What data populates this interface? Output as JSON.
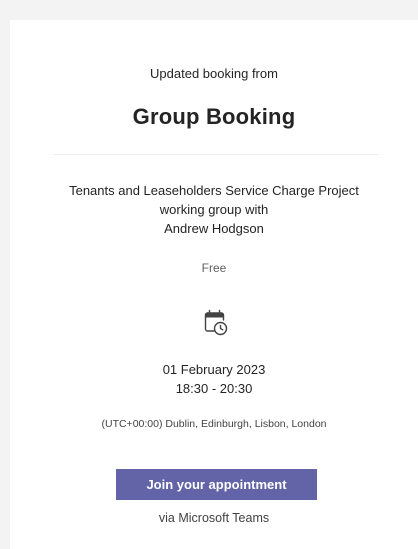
{
  "booking": {
    "intro": "Updated booking from",
    "business_name": "Group Booking",
    "service_lines": [
      "Tenants and Leaseholders Service Charge Project",
      "working group with",
      "Andrew Hodgson"
    ],
    "price": "Free",
    "icon": "calendar-clock-icon",
    "date": "01 February 2023",
    "time": "18:30 - 20:30",
    "timezone": "(UTC+00:00) Dublin, Edinburgh, Lisbon, London",
    "join_button_label": "Join your appointment",
    "via": "via Microsoft Teams"
  },
  "colors": {
    "accent": "#6264a7",
    "page_background": "#f3f3f3",
    "card_background": "#ffffff",
    "text": "#242424"
  }
}
